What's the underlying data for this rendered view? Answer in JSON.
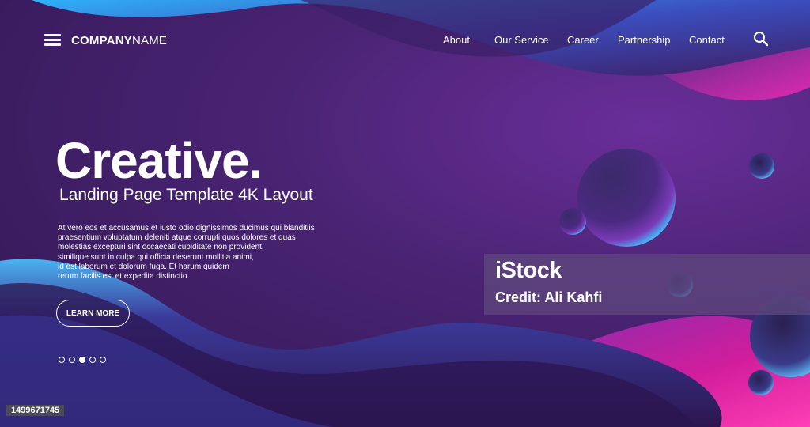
{
  "nav": {
    "brand_bold": "COMPANY",
    "brand_light": "NAME",
    "links": [
      "About",
      "Our Service",
      "Career",
      "Partnership",
      "Contact"
    ],
    "menu_icon": "hamburger-menu-icon",
    "search_icon": "search-icon"
  },
  "hero": {
    "title": "Creative.",
    "subtitle": "Landing Page Template 4K Layout",
    "body": [
      "At vero eos et accusamus et iusto odio dignissimos ducimus qui blanditiis",
      "praesentium voluptatum deleniti atque corrupti quos dolores et quas",
      "molestias excepturi sint occaecati cupiditate non provident,",
      "similique sunt in culpa qui officia deserunt mollitia animi,",
      "id est laborum et dolorum fuga. Et harum quidem",
      "rerum facilis est et expedita distinctio."
    ],
    "button_label": "LEARN MORE"
  },
  "slider": {
    "count": 5,
    "active_index": 2
  },
  "watermark": {
    "logo": "iStock",
    "credit": "Credit: Ali Kahfi"
  },
  "image_id": "1499671745",
  "colors": {
    "background": "#3e1f63",
    "accent_blue": "#3fa9f5",
    "accent_magenta": "#c2188f"
  }
}
